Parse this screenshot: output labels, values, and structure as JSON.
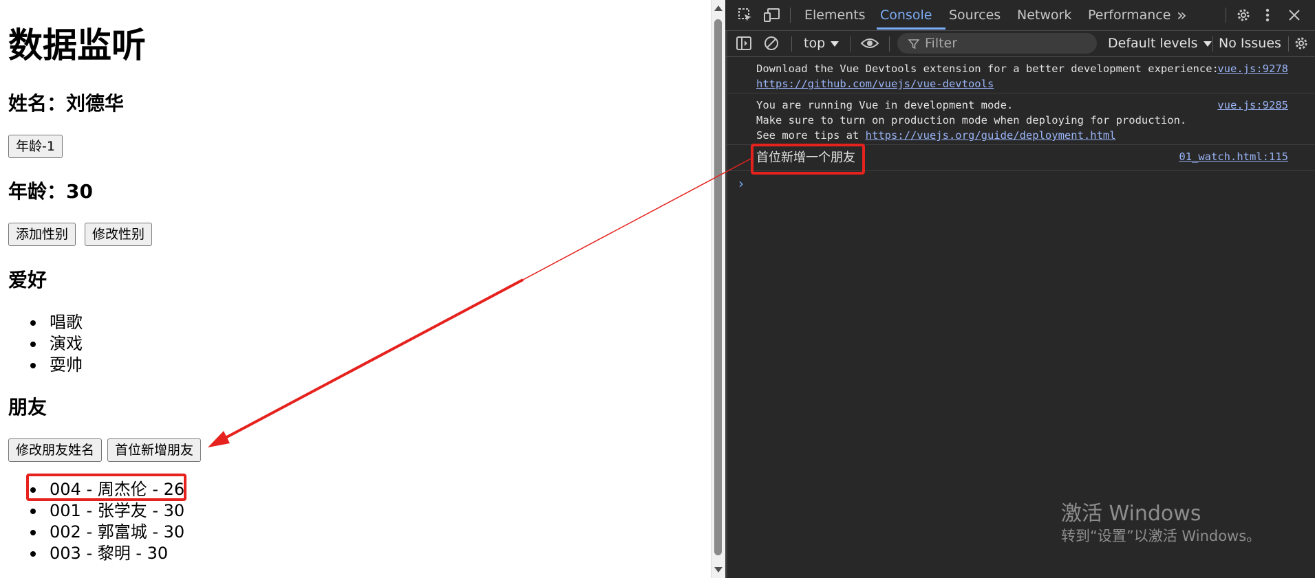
{
  "page": {
    "title": "数据监听",
    "name_label": "姓名：刘德华",
    "age_minus_button": "年龄-1",
    "age_label": "年龄：30",
    "add_gender_button": "添加性别",
    "modify_gender_button": "修改性别",
    "hobbies_heading": "爱好",
    "hobbies": [
      "唱歌",
      "演戏",
      "耍帅"
    ],
    "friends_heading": "朋友",
    "modify_friend_button": "修改朋友姓名",
    "add_friend_first_button": "首位新增朋友",
    "friends": [
      "004 - 周杰伦 - 26",
      "001 - 张学友 - 30",
      "002 - 郭富城 - 30",
      "003 - 黎明 - 30"
    ]
  },
  "devtools": {
    "tabs": [
      "Elements",
      "Console",
      "Sources",
      "Network",
      "Performance"
    ],
    "active_tab": "Console",
    "more_tabs": "»",
    "toolbar": {
      "context": "top",
      "filter_placeholder": "Filter",
      "levels": "Default levels",
      "issues": "No Issues"
    },
    "console": {
      "msg1_line1": "Download the Vue Devtools extension for a better development experience:",
      "msg1_link": "https://github.com/vuejs/vue-devtools",
      "msg1_src": "vue.js:9278",
      "msg2_line1": "You are running Vue in development mode.",
      "msg2_line2": "Make sure to turn on production mode when deploying for production.",
      "msg2_line3_prefix": "See more tips at ",
      "msg2_link": "https://vuejs.org/guide/deployment.html",
      "msg2_src": "vue.js:9285",
      "msg3_text": "首位新增一个朋友",
      "msg3_src": "01_watch.html:115",
      "prompt": "›"
    }
  },
  "watermark": {
    "line1": "激活 Windows",
    "line2": "转到“设置”以激活 Windows。"
  },
  "colors": {
    "annotation_red": "#e5221e",
    "devtools_bg": "#282828",
    "link_blue": "#9ab4f7",
    "active_tab": "#7cacf8"
  }
}
